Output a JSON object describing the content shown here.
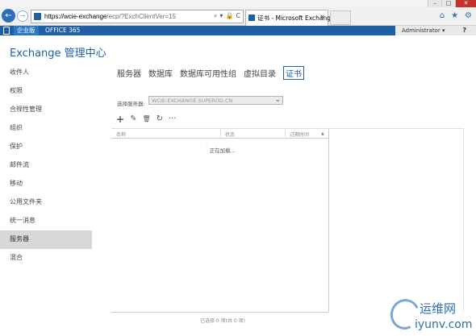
{
  "window": {
    "minimize": "–",
    "maximize": "□",
    "close": "✕"
  },
  "browser": {
    "url_host": "https://wcie-exchange",
    "url_path": "/ecp/?ExchClientVer=15",
    "url_controls": [
      "⌕",
      "▾",
      "🔒",
      "C"
    ],
    "tab_title": "证书 - Microsoft Exchange",
    "tab_close": "×",
    "tools": [
      "⌂",
      "★",
      "⚙"
    ]
  },
  "ecp_topbar": {
    "enterprise": "企业版",
    "office365": "OFFICE 365",
    "user": "Administrator",
    "user_caret": "▾",
    "help": "?"
  },
  "app_title": "Exchange 管理中心",
  "left_nav": [
    {
      "label": "收件人",
      "selected": false
    },
    {
      "label": "权限",
      "selected": false
    },
    {
      "label": "合规性管理",
      "selected": false
    },
    {
      "label": "组织",
      "selected": false
    },
    {
      "label": "保护",
      "selected": false
    },
    {
      "label": "邮件流",
      "selected": false
    },
    {
      "label": "移动",
      "selected": false
    },
    {
      "label": "公用文件夹",
      "selected": false
    },
    {
      "label": "统一消息",
      "selected": false
    },
    {
      "label": "服务器",
      "selected": true
    },
    {
      "label": "混合",
      "selected": false
    }
  ],
  "sub_nav": [
    {
      "label": "服务器",
      "current": false
    },
    {
      "label": "数据库",
      "current": false
    },
    {
      "label": "数据库可用性组",
      "current": false
    },
    {
      "label": "虚拟目录",
      "current": false
    },
    {
      "label": "证书",
      "current": true
    }
  ],
  "server_select": {
    "label": "选择服务器:",
    "value": "WCIE-EXCHANGE.SUPEROD.CN"
  },
  "toolbar": {
    "add": "+",
    "edit": "✎",
    "delete": "🗑",
    "refresh": "↻",
    "more": "···"
  },
  "grid": {
    "columns": [
      "名称",
      "状态",
      "过期时间"
    ],
    "sort_indicator": "▲",
    "loading_text": "正在加载...",
    "footer": "已选择 0 项(共 0 项)"
  },
  "watermark": {
    "line1": "运维网",
    "line2": "iyunv.com"
  },
  "colors": {
    "brand_blue": "#1f5fa6",
    "selected_nav_bg": "#d8d8d8",
    "close_red": "#c7302b"
  }
}
